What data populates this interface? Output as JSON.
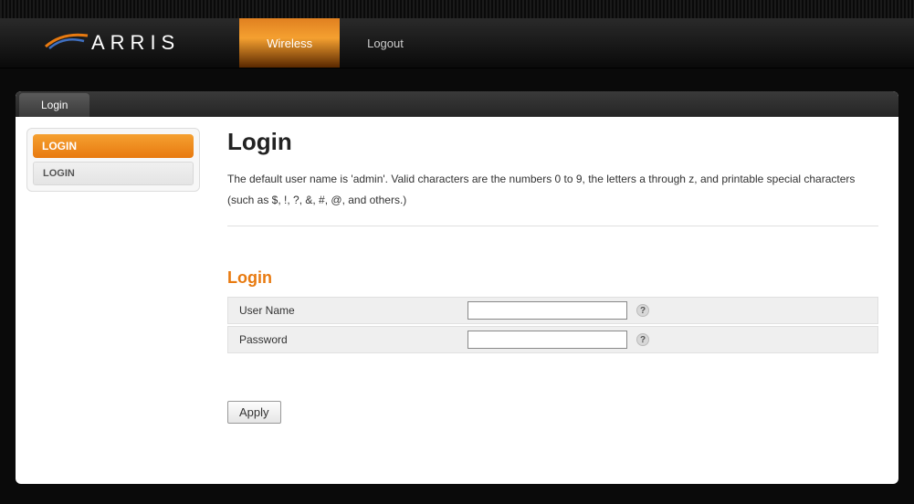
{
  "brand": "ARRIS",
  "nav": {
    "wireless": "Wireless",
    "logout": "Logout"
  },
  "tabs": {
    "login": "Login"
  },
  "sidebar": {
    "heading": "LOGIN",
    "items": [
      "LOGIN"
    ]
  },
  "page": {
    "title": "Login",
    "intro": "The default user name is 'admin'. Valid characters are the numbers 0 to 9, the letters a through z, and printable special characters (such as $, !, ?, &, #, @, and others.)",
    "section_title": "Login",
    "username_label": "User Name",
    "password_label": "Password",
    "username_value": "",
    "password_value": "",
    "help_glyph": "?",
    "apply_label": "Apply"
  }
}
